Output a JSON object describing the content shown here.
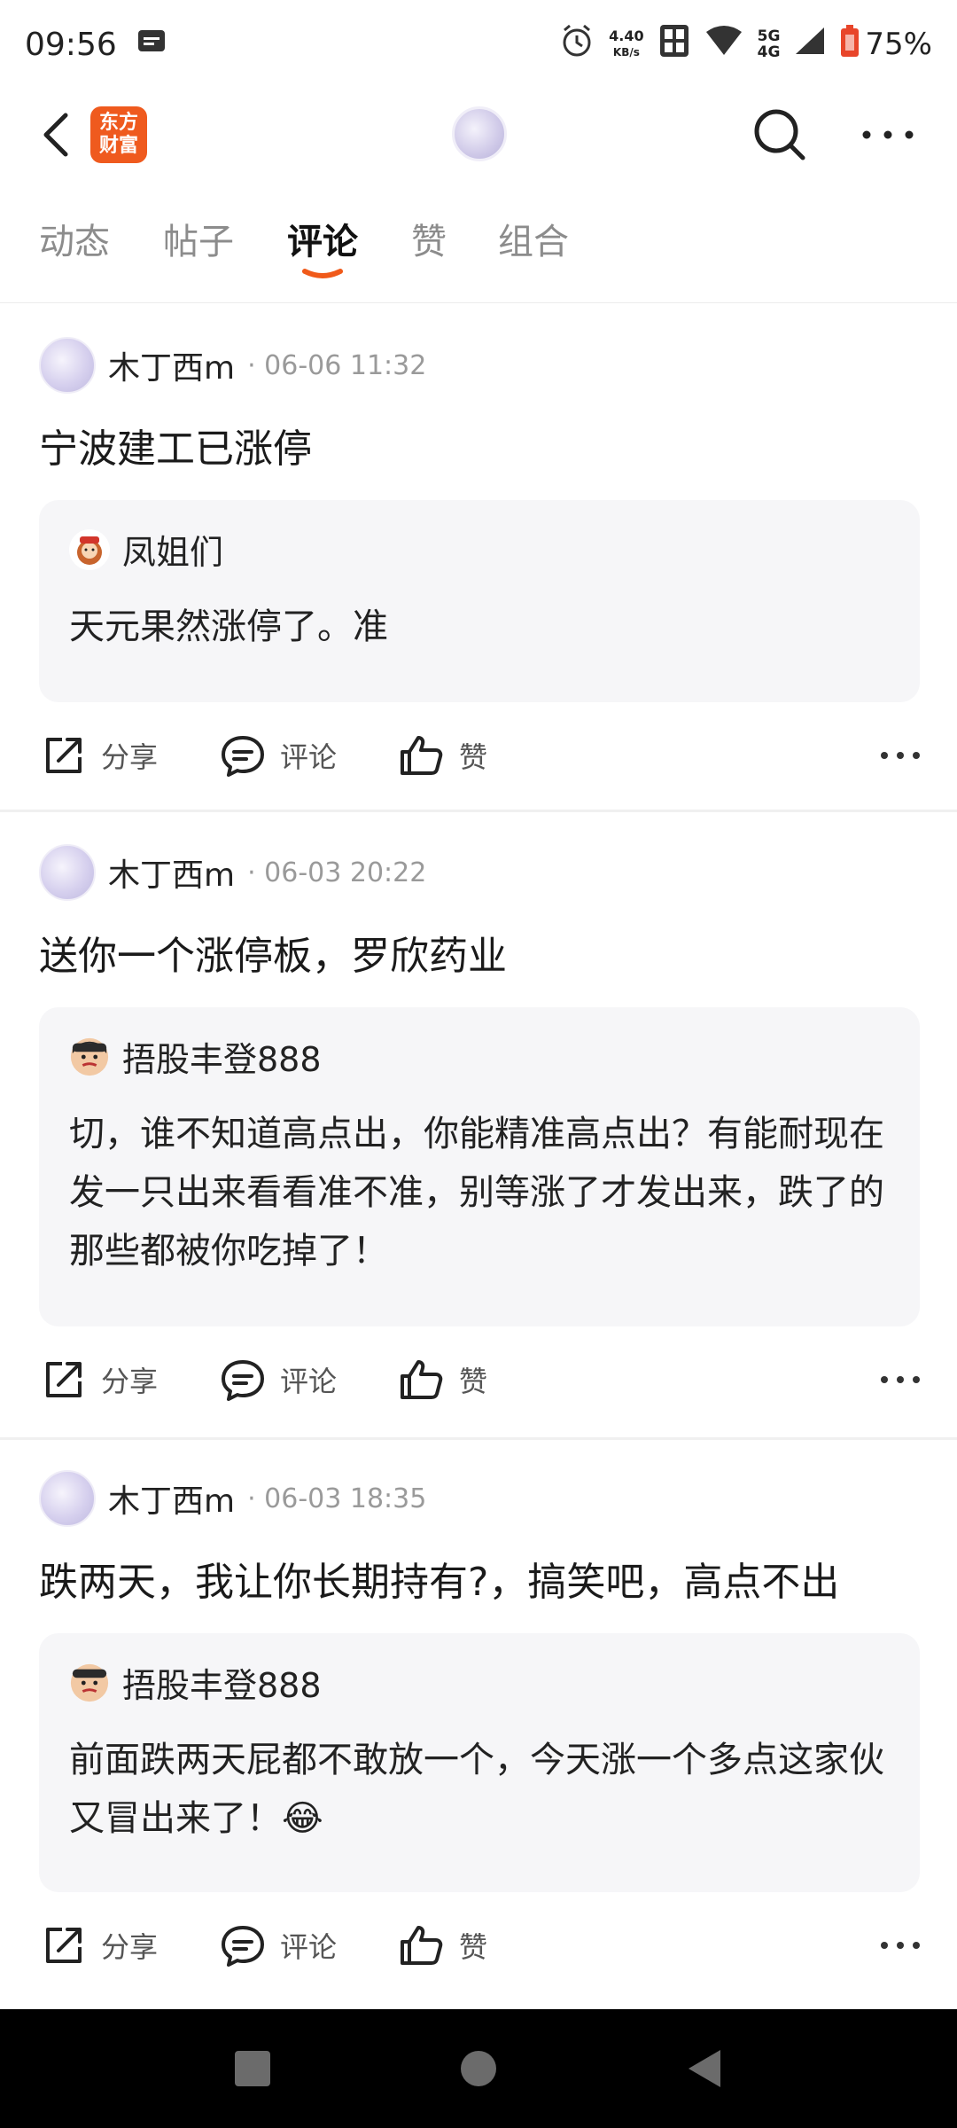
{
  "status_bar": {
    "time": "09:56",
    "net_speed_value": "4.40",
    "net_speed_unit": "KB/s",
    "signal_label_top": "5G",
    "signal_label_bottom": "4G",
    "battery": "75%"
  },
  "header": {
    "logo_text": "东方财富",
    "icons": [
      "back-icon",
      "search-icon",
      "more-icon"
    ]
  },
  "tabs": [
    {
      "label": "动态"
    },
    {
      "label": "帖子"
    },
    {
      "label": "评论"
    },
    {
      "label": "赞"
    },
    {
      "label": "组合"
    }
  ],
  "active_tab": "评论",
  "actions": {
    "share": "分享",
    "comment": "评论",
    "like": "赞"
  },
  "posts": [
    {
      "user": "木丁西m",
      "time": "· 06-06 11:32",
      "body": "宁波建工已涨停",
      "quote_user": "凤姐们",
      "quote_text": "天元果然涨停了。准"
    },
    {
      "user": "木丁西m",
      "time": "· 06-03 20:22",
      "body": "送你一个涨停板，罗欣药业",
      "quote_user": "捂股丰登888",
      "quote_text": "切，谁不知道高点出，你能精准高点出？有能耐现在发一只出来看看准不准，别等涨了才发出来，跌了的那些都被你吃掉了！"
    },
    {
      "user": "木丁西m",
      "time": "· 06-03 18:35",
      "body": "跌两天，我让你长期持有?，搞笑吧，高点不出",
      "quote_user": "捂股丰登888",
      "quote_text": "前面跌两天屁都不敢放一个，今天涨一个多点这家伙又冒出来了！😂"
    }
  ],
  "colors": {
    "accent": "#ef5a1e",
    "quote_bg": "#f6f6f8"
  }
}
